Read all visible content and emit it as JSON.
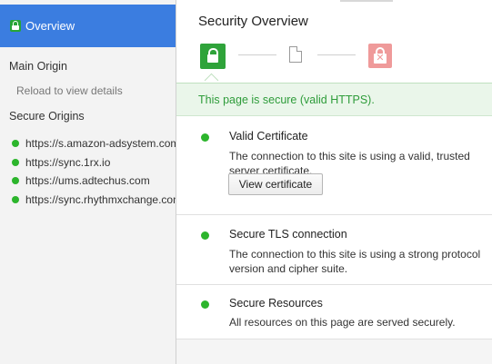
{
  "sidebar": {
    "overview_label": "Overview",
    "main_origin_title": "Main Origin",
    "reload_hint": "Reload to view details",
    "secure_origins_title": "Secure Origins",
    "origins": [
      "https://s.amazon-adsystem.com",
      "https://sync.1rx.io",
      "https://ums.adtechus.com",
      "https://sync.rhythmxchange.com"
    ]
  },
  "main": {
    "title": "Security Overview",
    "banner": "This page is secure (valid HTTPS).",
    "cards": [
      {
        "title": "Valid Certificate",
        "description": "The connection to this site is using a valid, trusted server certificate.",
        "button_label": "View certificate"
      },
      {
        "title": "Secure TLS connection",
        "description": "The connection to this site is using a strong protocol version and cipher suite."
      },
      {
        "title": "Secure Resources",
        "description": "All resources on this page are served securely."
      }
    ]
  },
  "icons": {
    "overview": "lock-icon",
    "secure_state": "lock-icon",
    "page_state": "document-icon",
    "insecure_state": "broken-lock-icon"
  },
  "colors": {
    "accent": "#3b7de0",
    "secure_green": "#2fa33a",
    "banner_bg": "#eaf6ea",
    "banner_text": "#2e9c3a",
    "insecure_red": "#ef9a9a",
    "status_dot": "#2cb52c"
  }
}
